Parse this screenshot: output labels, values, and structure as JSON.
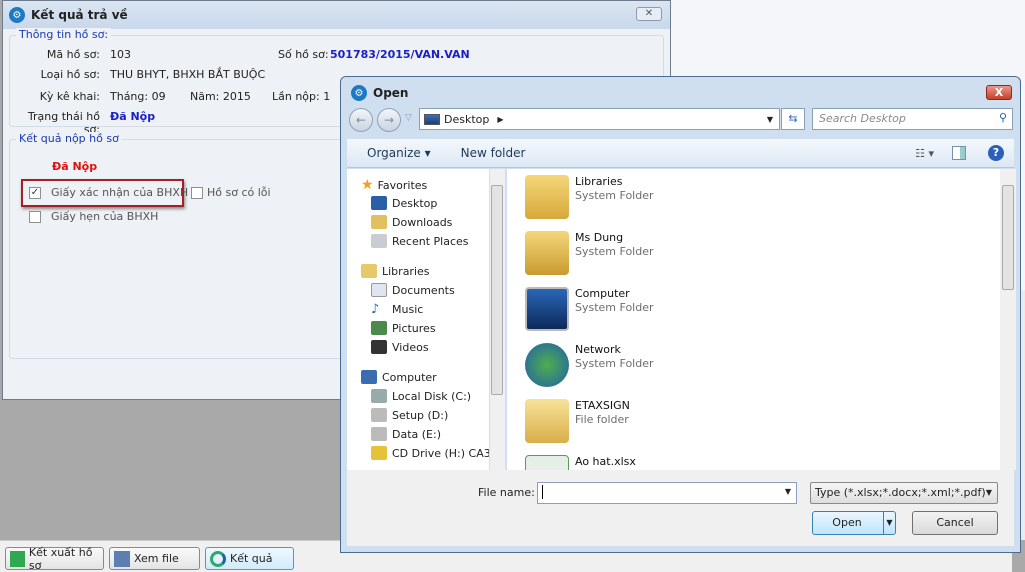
{
  "main_window": {
    "title": "Kết quả trả về",
    "close": "✕",
    "info_group": "Thông tin hồ sơ:",
    "ma_ho_so_label": "Mã hồ sơ:",
    "ma_ho_so": "103",
    "so_ho_so_label": "Số hồ sơ:",
    "so_ho_so": "501783/2015/VAN.VAN",
    "loai_ho_so_label": "Loại hồ sơ:",
    "loai_ho_so": "THU BHYT, BHXH BẮT BUỘC",
    "ky_ke_khai_label": "Kỳ kê khai:",
    "thang": "Tháng: 09",
    "nam": "Năm: 2015",
    "lan_nop": "Lần nộp: 1",
    "trang_thai_label": "Trạng thái hồ sơ:",
    "trang_thai": "Đã Nộp",
    "result_group": "Kết quả nộp hồ sơ",
    "result_status": "Đã Nộp",
    "checkboxes": [
      {
        "label": "Giấy xác nhận của BHXH",
        "checked": true
      },
      {
        "label": "Hồ sơ có lỗi",
        "checked": false
      },
      {
        "label": "Giấy hẹn của BHXH",
        "checked": false
      }
    ]
  },
  "bottom_buttons": [
    "Kết xuất hồ sơ",
    "Xem file",
    "Kết quả"
  ],
  "open_dialog": {
    "title": "Open",
    "close": "X",
    "address": "Desktop",
    "search_placeholder": "Search Desktop",
    "toolbar": {
      "organize": "Organize ▾",
      "new_folder": "New folder"
    },
    "nav": {
      "favorites": "Favorites",
      "fav_items": [
        "Desktop",
        "Downloads",
        "Recent Places"
      ],
      "libraries": "Libraries",
      "lib_items": [
        "Documents",
        "Music",
        "Pictures",
        "Videos"
      ],
      "computer": "Computer",
      "comp_items": [
        "Local Disk (C:)",
        "Setup (D:)",
        "Data (E:)",
        "CD Drive (H:) CA3"
      ]
    },
    "files": [
      {
        "name": "Libraries",
        "type": "System Folder"
      },
      {
        "name": "Ms Dung",
        "type": "System Folder"
      },
      {
        "name": "Computer",
        "type": "System Folder"
      },
      {
        "name": "Network",
        "type": "System Folder"
      },
      {
        "name": "ETAXSIGN",
        "type": "File folder"
      },
      {
        "name": "Ao hat.xlsx",
        "type": ""
      }
    ],
    "file_name_label": "File name:",
    "file_name": "",
    "file_type": "Type (*.xlsx;*.docx;*.xml;*.pdf)",
    "open_button": "Open",
    "cancel_button": "Cancel"
  },
  "colors": {
    "accent_blue": "#1a20c8",
    "status_red": "#e01010",
    "highlight_border": "#a42024"
  }
}
